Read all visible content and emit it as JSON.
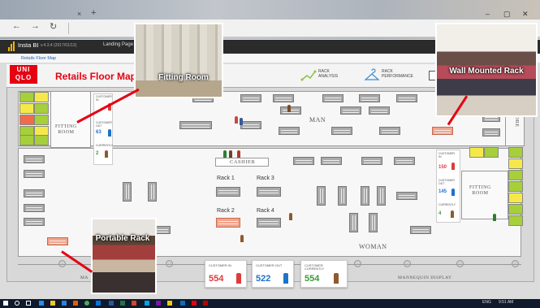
{
  "browser": {
    "tab_close": "×",
    "tab_add": "+",
    "back": "←",
    "forward": "→",
    "reload": "↻",
    "min": "–",
    "max": "▢",
    "close": "✕"
  },
  "app": {
    "title": "Insta BI",
    "version": "v.4.3.4 (2017/01/13)",
    "landing": "Landing Page",
    "breadcrumb": "Retails Floor Map"
  },
  "map": {
    "brand_line1": "UNI",
    "brand_line2": "QLO",
    "title": "Retails Floor Map",
    "legend_rack_analysis": "RACK\nANALYSIS",
    "legend_rack_performance": "RACK\nPERFORMANCE",
    "section_man": "MAN",
    "section_woman": "WOMAN",
    "section_store": "STORE",
    "cashier": "CASHIER",
    "mannequin_display": "MANNEQUIN DISPLAY",
    "mannequin_left": "MA",
    "fitting_left_line1": "FITTING",
    "fitting_left_line2": "ROOM",
    "fitting_right_line1": "FITTING",
    "fitting_right_line2": "ROOM",
    "rack_labels": [
      "Rack 1",
      "Rack 3",
      "Rack 2",
      "Rack 4"
    ]
  },
  "left_fitting_stats": {
    "in_label": "CUSTOMER IN",
    "in_value": "",
    "out_label": "CUSTOMER OUT",
    "out_value": "63",
    "current_label": "CURRENTLY",
    "current_value": "2"
  },
  "right_fitting_stats": {
    "in_label": "CUSTOMER IN",
    "in_value": "150",
    "out_label": "CUSTOMER OUT",
    "out_value": "145",
    "current_label": "CURRENTLY",
    "current_value": "4"
  },
  "totals": {
    "in_label": "CUSTOMER IN",
    "in_value": "554",
    "out_label": "CUSTOMER OUT",
    "out_value": "522",
    "current_label": "CUSTOMER CURRENTLY",
    "current_value": "554"
  },
  "callouts": {
    "fitting_room": "Fitting Room",
    "wall_mounted_rack": "Wall Mounted Rack",
    "portable_rack": "Portable Rack"
  },
  "taskbar": {
    "lang": "ENG",
    "time": "9:51 AM"
  },
  "colors": {
    "brand_red": "#e60012",
    "in_color": "#e03a3a",
    "out_color": "#1c73c9",
    "current_color": "#3a9a3a"
  }
}
